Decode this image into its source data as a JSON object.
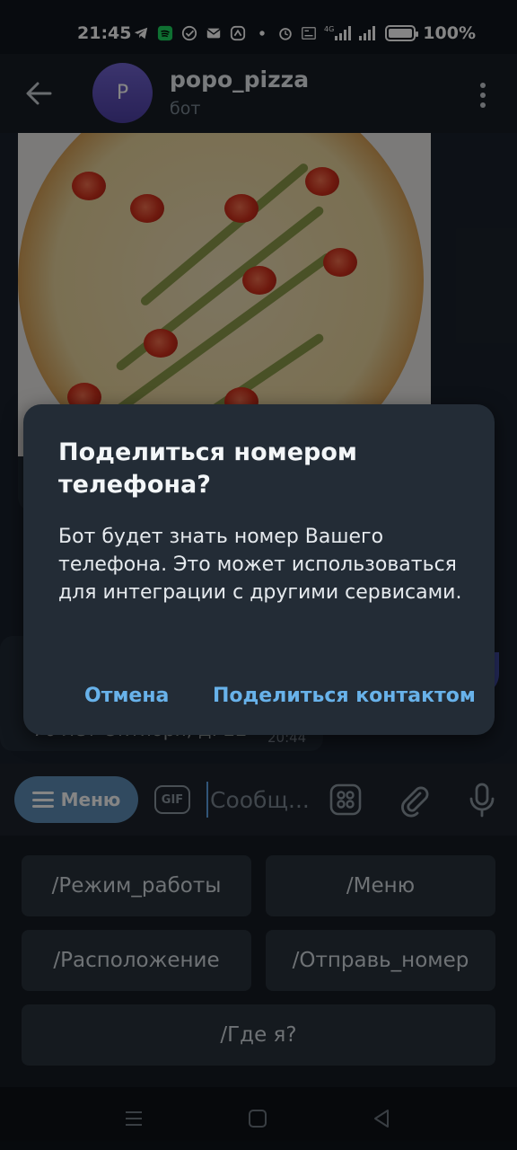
{
  "status_bar": {
    "time": "21:45",
    "battery": "100%",
    "battery_level": 1.0,
    "network_label": "4G"
  },
  "chat_header": {
    "avatar_letter": "P",
    "title": "popo_pizza",
    "subtitle": "бот"
  },
  "chat": {
    "message_partial_text": "70 лет Октября, д. 22",
    "message_time": "20:44"
  },
  "dialog": {
    "title": "Поделиться номером телефона?",
    "body": "Бот будет знать номер Вашего телефона. Это может использоваться для интеграции с другими сервисами.",
    "cancel_label": "Отмена",
    "confirm_label": "Поделиться контактом"
  },
  "input_bar": {
    "menu_label": "Меню",
    "gif_label": "GIF",
    "placeholder": "Сообщ..."
  },
  "bot_keyboard": {
    "rows": [
      [
        "/Режим_работы",
        "/Меню"
      ],
      [
        "/Расположение",
        "/Отправь_номер"
      ],
      [
        "/Где я?"
      ]
    ]
  },
  "colors": {
    "accent": "#68b2ea",
    "menu_button": "#5e8eb9",
    "avatar": "#6356c6"
  }
}
